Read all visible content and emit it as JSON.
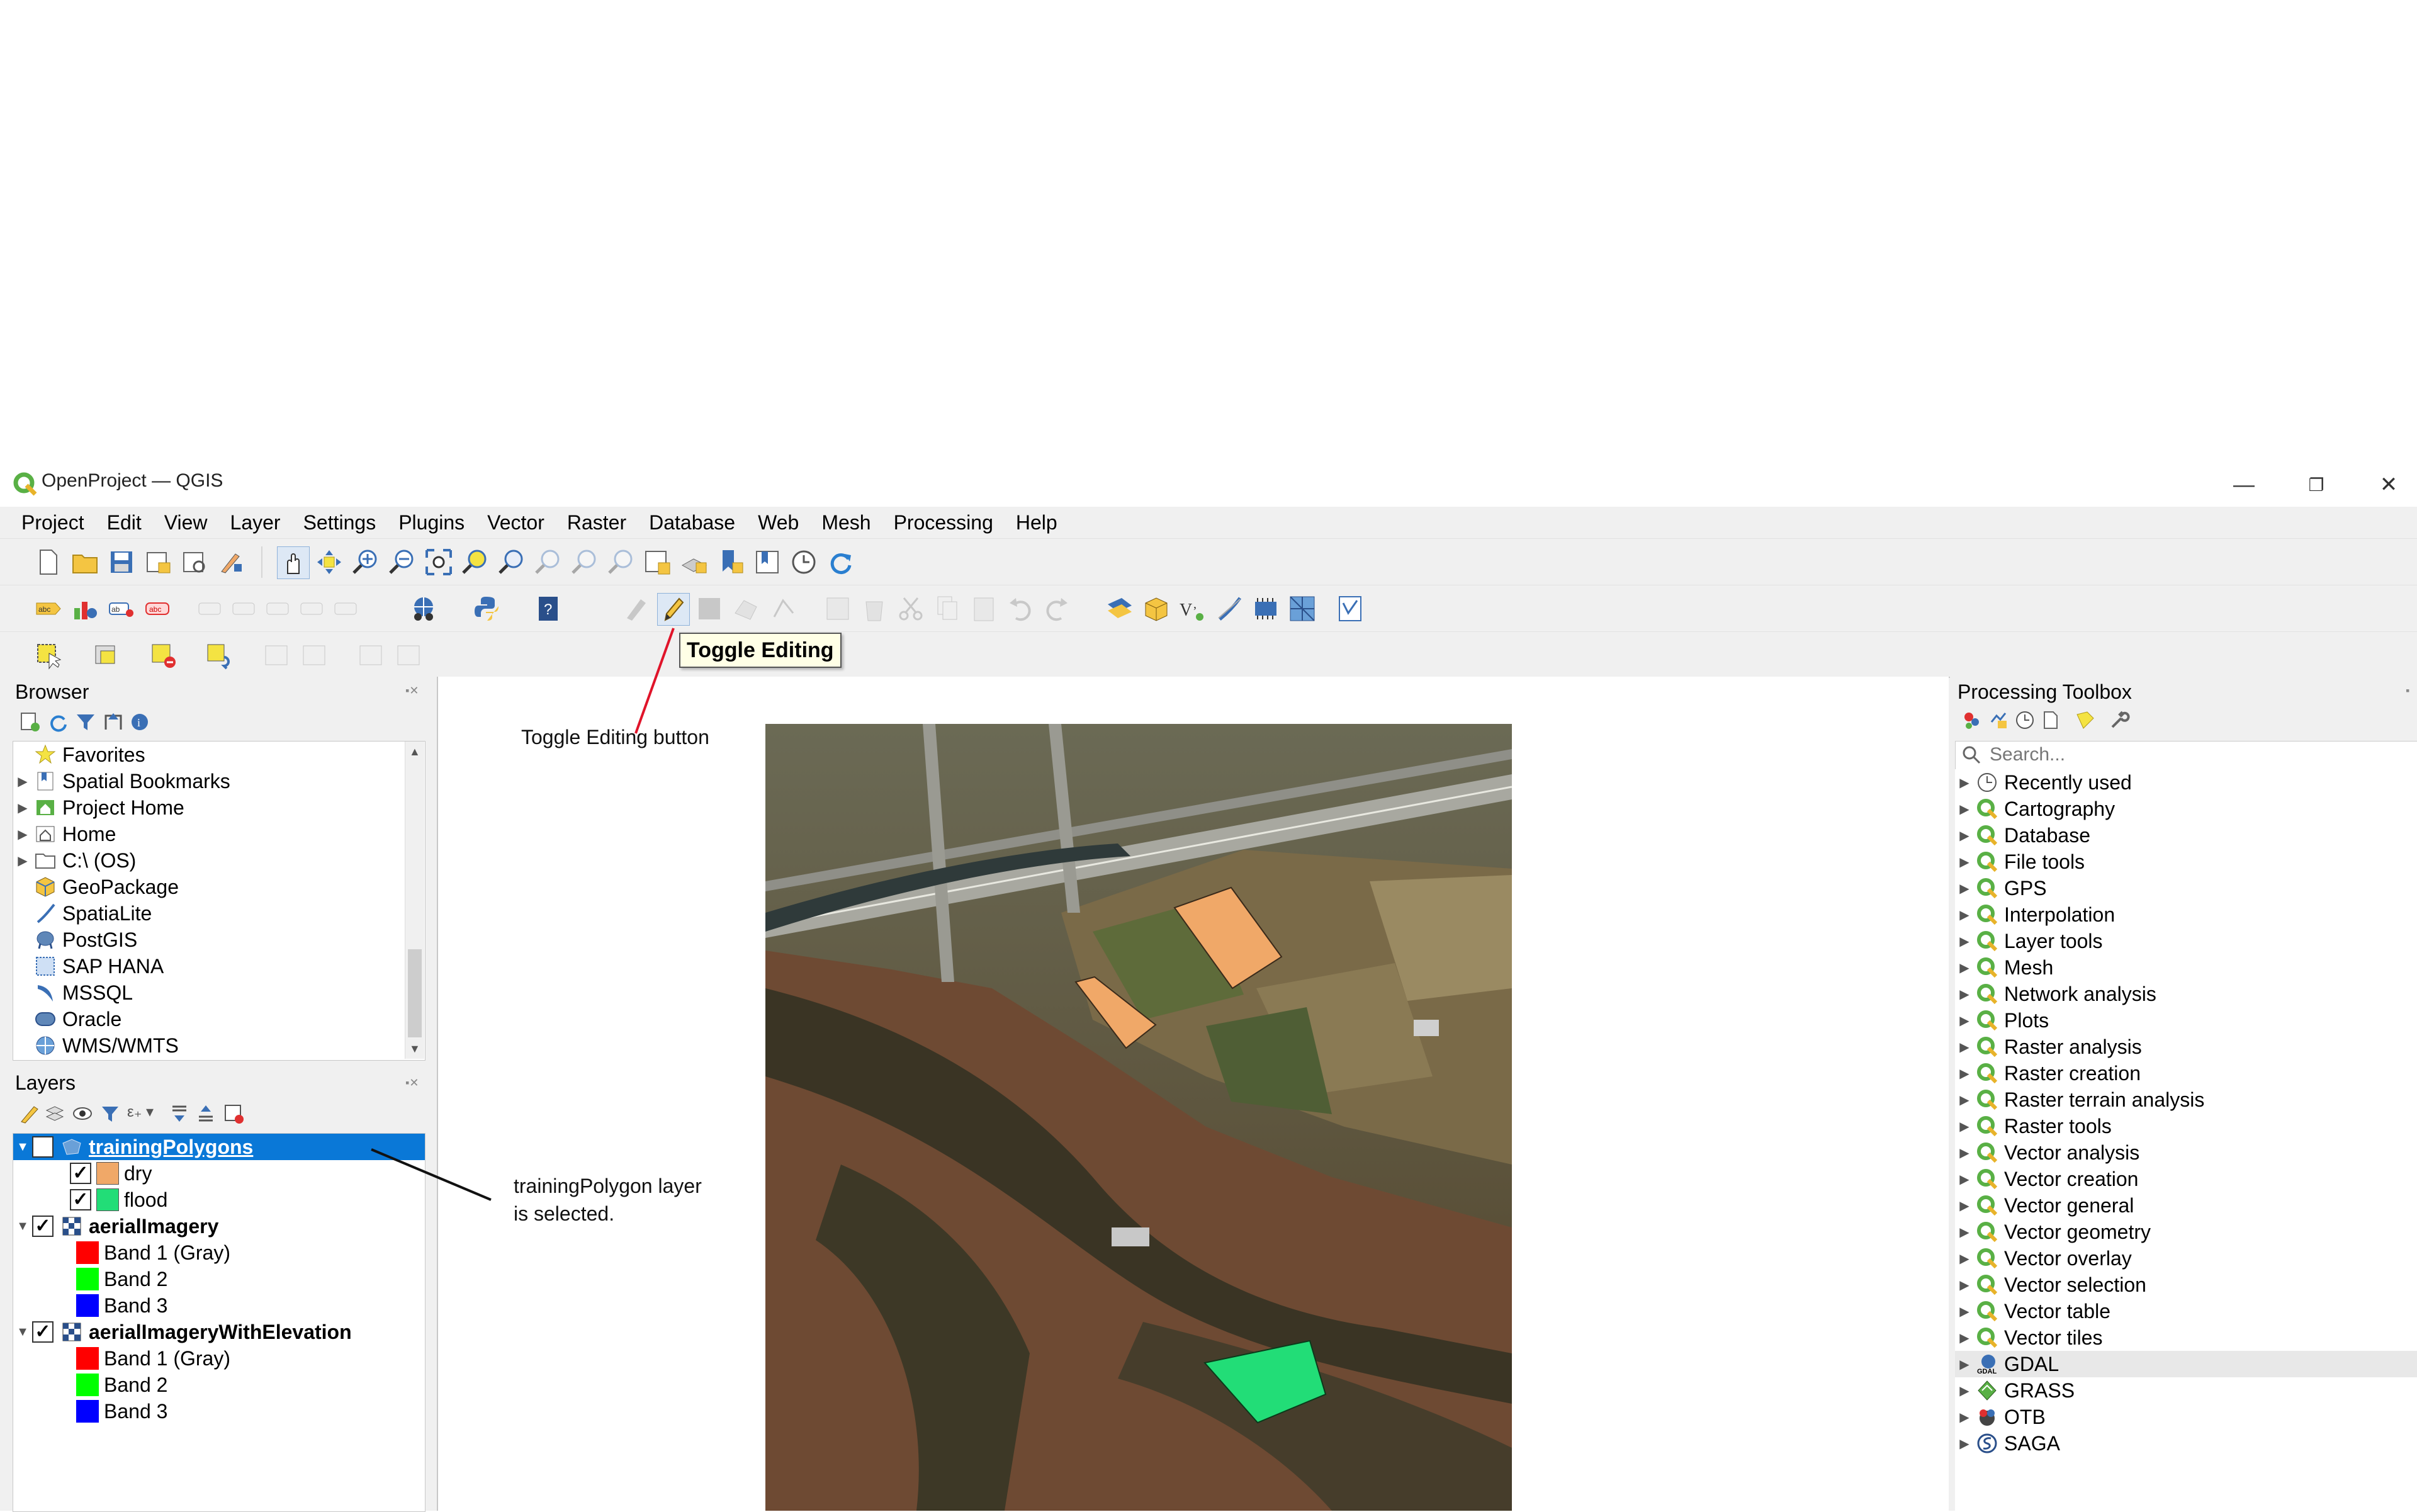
{
  "window": {
    "title": "OpenProject — QGIS",
    "minimize_glyph": "—",
    "restore_glyph": "❐",
    "close_glyph": "✕"
  },
  "menubar": [
    "Project",
    "Edit",
    "View",
    "Layer",
    "Settings",
    "Plugins",
    "Vector",
    "Raster",
    "Database",
    "Web",
    "Mesh",
    "Processing",
    "Help"
  ],
  "tooltip": "Toggle Editing",
  "browser": {
    "title": "Browser",
    "items": [
      "Favorites",
      "Spatial Bookmarks",
      "Project Home",
      "Home",
      "C:\\ (OS)",
      "GeoPackage",
      "SpatiaLite",
      "PostGIS",
      "SAP HANA",
      "MSSQL",
      "Oracle",
      "WMS/WMTS"
    ]
  },
  "layers": {
    "title": "Layers",
    "items": [
      {
        "label": "trainingPolygons",
        "selected": true
      },
      {
        "label": "dry",
        "color": "#f0a868"
      },
      {
        "label": "flood",
        "color": "#22dd77"
      },
      {
        "label": "aerialImagery"
      },
      {
        "label": "Band 1 (Gray)",
        "color": "#ff0000"
      },
      {
        "label": "Band 2",
        "color": "#00ff00"
      },
      {
        "label": "Band 3",
        "color": "#0000ff"
      },
      {
        "label": "aerialImageryWithElevation"
      },
      {
        "label": "Band 1 (Gray)",
        "color": "#ff0000"
      },
      {
        "label": "Band 2",
        "color": "#00ff00"
      },
      {
        "label": "Band 3",
        "color": "#0000ff"
      }
    ]
  },
  "toolbox": {
    "title": "Processing Toolbox",
    "search_placeholder": "Search...",
    "items": [
      "Recently used",
      "Cartography",
      "Database",
      "File tools",
      "GPS",
      "Interpolation",
      "Layer tools",
      "Mesh",
      "Network analysis",
      "Plots",
      "Raster analysis",
      "Raster creation",
      "Raster terrain analysis",
      "Raster tools",
      "Vector analysis",
      "Vector creation",
      "Vector general",
      "Vector geometry",
      "Vector overlay",
      "Vector selection",
      "Vector table",
      "Vector tiles",
      "GDAL",
      "GRASS",
      "OTB",
      "SAGA"
    ]
  },
  "annotations": {
    "toggle_note": "Toggle Editing button",
    "layer_note_line1": "trainingPolygon layer",
    "layer_note_line2": "is selected."
  },
  "colors": {
    "selection": "#0a78d7",
    "dry_polygon": "#f0a868",
    "flood_polygon": "#22dd77",
    "annotation_line": "#e0142a"
  }
}
